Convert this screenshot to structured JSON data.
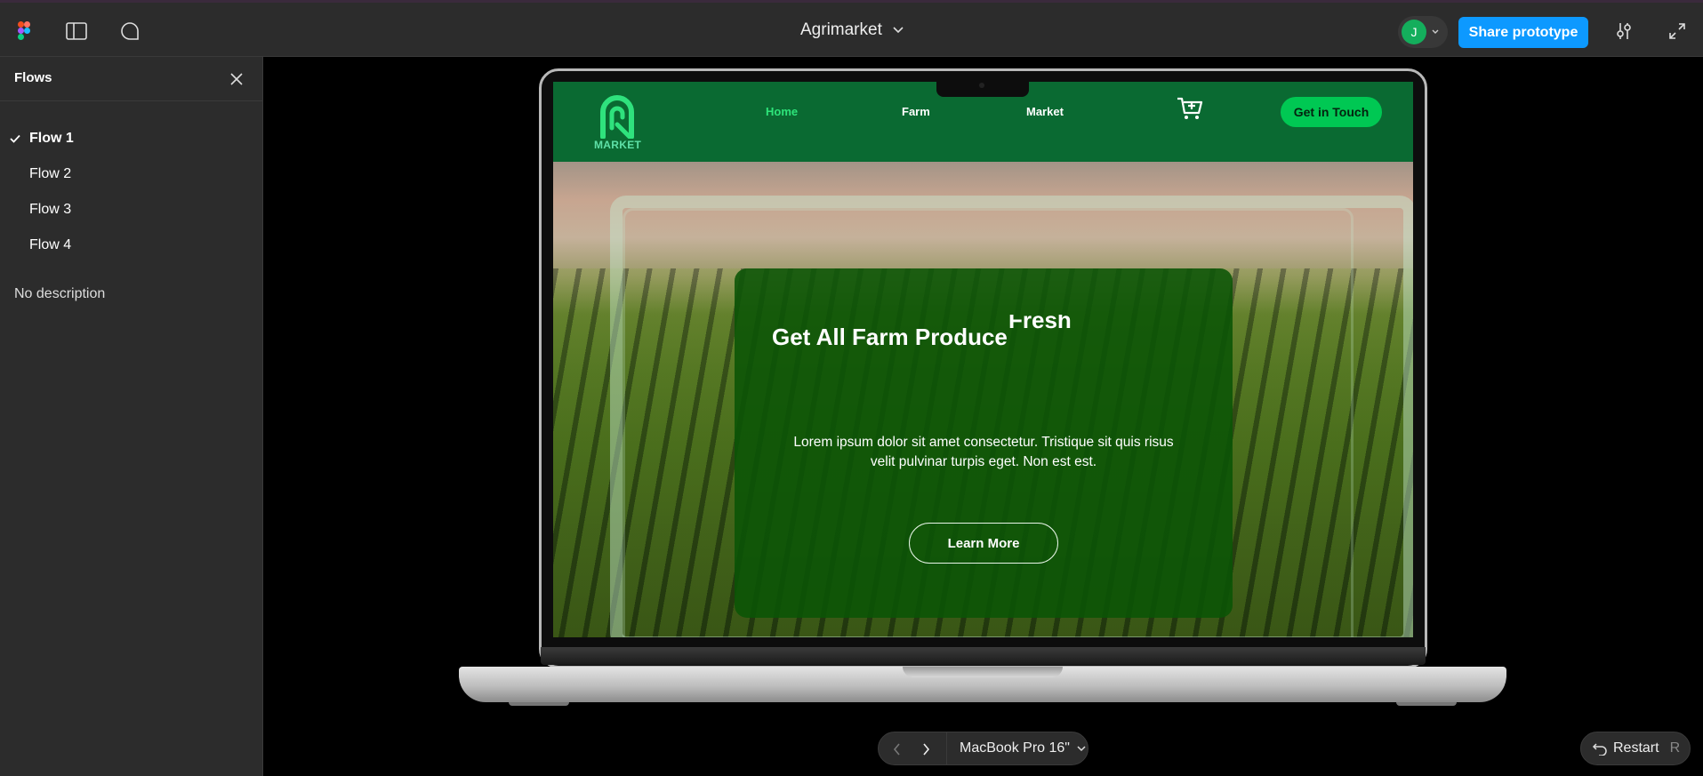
{
  "app": {
    "file_title": "Agrimarket",
    "avatar_initial": "J",
    "share_label": "Share prototype",
    "accent_color": "#0d99ff",
    "avatar_color": "#14ae5c"
  },
  "sidebar": {
    "title": "Flows",
    "flows": [
      {
        "label": "Flow 1",
        "active": true
      },
      {
        "label": "Flow 2",
        "active": false
      },
      {
        "label": "Flow 3",
        "active": false
      },
      {
        "label": "Flow 4",
        "active": false
      }
    ],
    "description": "No description"
  },
  "site": {
    "logo_text": "MARKET",
    "nav": [
      "Home",
      "Farm",
      "Market"
    ],
    "active_nav": "Home",
    "cta_label": "Get in Touch",
    "hero_title": "Get All Farm Produce",
    "hero_word": "Fresh",
    "hero_text": "Lorem ipsum dolor sit amet consectetur. Tristique sit quis risus velit pulvinar turpis eget. Non est est.",
    "hero_button": "Learn More",
    "brand_green": "#0a6a32",
    "highlight_green": "#2ee47a"
  },
  "controls": {
    "device": "MacBook Pro 16\"",
    "restart_label": "Restart",
    "restart_key": "R"
  }
}
